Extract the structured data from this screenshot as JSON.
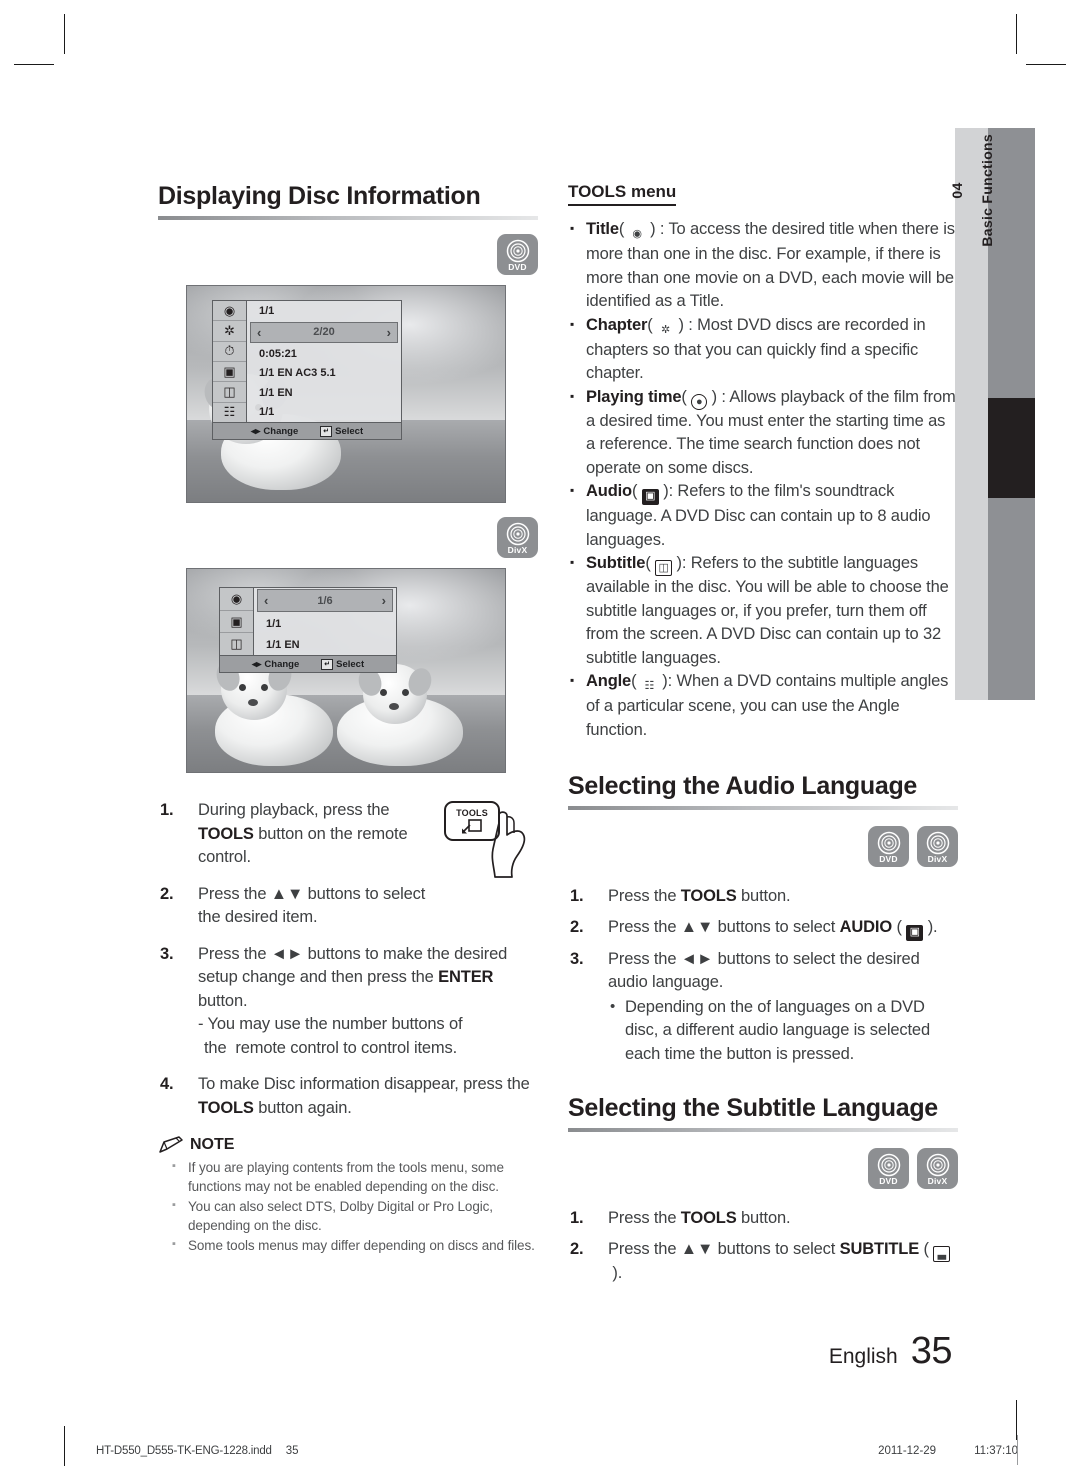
{
  "tab": {
    "number": "04",
    "label": "Basic Functions"
  },
  "left": {
    "heading": "Displaying Disc Information",
    "badge_dvd": "DVD",
    "badge_divx": "DivX",
    "osd1": {
      "rows": [
        {
          "icon": "title-icon",
          "value": "1/1",
          "selected": false
        },
        {
          "icon": "chapter-icon",
          "value": "2/20",
          "selected": true
        },
        {
          "icon": "playing-time-icon",
          "value": "0:05:21",
          "selected": false
        },
        {
          "icon": "audio-icon",
          "value": "1/1 EN AC3 5.1",
          "selected": false
        },
        {
          "icon": "subtitle-icon",
          "value": "1/1 EN",
          "selected": false
        },
        {
          "icon": "angle-icon",
          "value": "1/1",
          "selected": false
        }
      ],
      "foot_change": "Change",
      "foot_select": "Select"
    },
    "osd2": {
      "rows": [
        {
          "icon": "title-icon",
          "value": "1/6",
          "selected": true
        },
        {
          "icon": "audio-icon",
          "value": "1/1",
          "selected": false
        },
        {
          "icon": "subtitle-icon",
          "value": "1/1 EN",
          "selected": false
        }
      ],
      "foot_change": "Change",
      "foot_select": "Select"
    },
    "steps": [
      {
        "num": "1.",
        "html": "During playback, press the <b>TOOLS</b> button on the remote control."
      },
      {
        "num": "2.",
        "html": "Press the ▲▼ buttons to select the desired item."
      },
      {
        "num": "3.",
        "html": "Press the ◄► buttons to make the desired setup change and then press the <b>ENTER</b> button.<span class=\"substep\">- You may use the number buttons of the&nbsp;&nbsp;remote control to control items.</span>"
      },
      {
        "num": "4.",
        "html": "To make Disc information disappear, press the <b>TOOLS</b> button again."
      }
    ],
    "remote_key_label": "TOOLS",
    "note_label": "NOTE",
    "notes": [
      "If you are playing contents from the tools menu, some functions may not be enabled depending on the disc.",
      "You can also select DTS, Dolby Digital or Pro Logic, depending on the disc.",
      "Some tools menus may differ depending on discs and files."
    ]
  },
  "right": {
    "tools_menu_title": "TOOLS menu",
    "tools_items": [
      {
        "term": "Title",
        "icon": "title-icon",
        "text": " : To access the desired title when there is more than one in the disc. For example, if there is more than one movie on a DVD, each movie will be identified as a Title."
      },
      {
        "term": "Chapter",
        "icon": "chapter-icon",
        "text": " : Most DVD discs are recorded in chapters so that you can quickly find a specific chapter."
      },
      {
        "term": "Playing time",
        "icon": "playing-time-icon",
        "text": " : Allows playback of the film from a desired time. You must enter the starting time as a reference. The time search function does not operate on some discs."
      },
      {
        "term": "Audio",
        "icon": "audio-icon",
        "text": ": Refers to the film's soundtrack language. A DVD Disc can contain up to 8 audio languages."
      },
      {
        "term": "Subtitle",
        "icon": "subtitle-icon",
        "text": ": Refers to the subtitle languages available in the disc. You will be able to choose the subtitle languages or, if you prefer, turn them off from the screen. A DVD Disc can contain up to 32 subtitle languages."
      },
      {
        "term": "Angle",
        "icon": "angle-icon",
        "text": ": When a DVD contains multiple angles of a particular scene, you can use the Angle function."
      }
    ],
    "audio_section": {
      "heading": "Selecting the Audio Language",
      "badge_dvd": "DVD",
      "badge_divx": "DivX",
      "steps": [
        {
          "num": "1.",
          "html": "Press the <b>TOOLS</b> button."
        },
        {
          "num": "2.",
          "html": "Press the ▲▼ buttons to select <b>AUDIO</b> ( <span class=\"g dark\" data-name=\"audio-icon\">▣</span> )."
        },
        {
          "num": "3.",
          "html": "Press the ◄► buttons to select the desired audio language.<span class=\"dotline\">Depending on the of languages on a DVD disc, a different audio language is selected each time the button is pressed.</span>"
        }
      ]
    },
    "subtitle_section": {
      "heading": "Selecting the Subtitle Language",
      "badge_dvd": "DVD",
      "badge_divx": "DivX",
      "steps": [
        {
          "num": "1.",
          "html": "Press the <b>TOOLS</b> button."
        },
        {
          "num": "2.",
          "html": "Press the ▲▼ buttons to select <b>SUBTITLE</b> ( <span class=\"g box\" data-name=\"subtitle-icon\">▃</span> )."
        }
      ]
    }
  },
  "footer": {
    "language": "English",
    "page_number": "35",
    "file_name": "HT-D550_D555-TK-ENG-1228.indd",
    "file_page": "35",
    "date": "2011-12-29",
    "time": "11:37:10"
  }
}
